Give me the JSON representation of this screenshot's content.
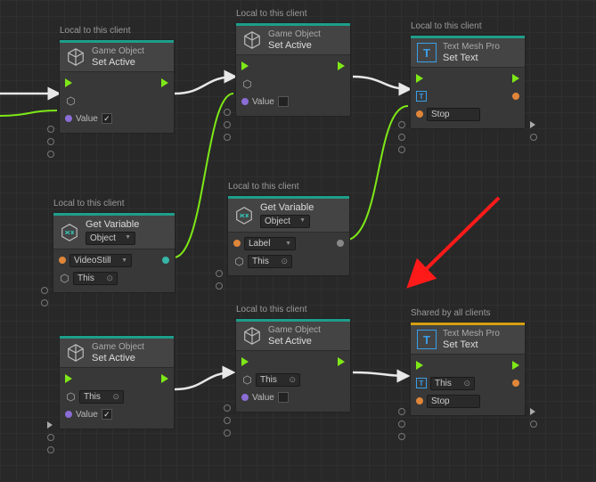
{
  "labels": {
    "local": "Local to this client",
    "shared": "Shared by all clients"
  },
  "headers": {
    "gameObject": "Game Object",
    "setActive": "Set Active",
    "getVariable": "Get Variable",
    "objectDropdown": "Object",
    "textMeshPro": "Text Mesh Pro",
    "setText": "Set Text"
  },
  "ports": {
    "value": "Value",
    "label": "Label",
    "this": "This",
    "stop": "Stop",
    "videoStill": "VideoStill"
  },
  "checkbox": {
    "checked": "✓"
  }
}
